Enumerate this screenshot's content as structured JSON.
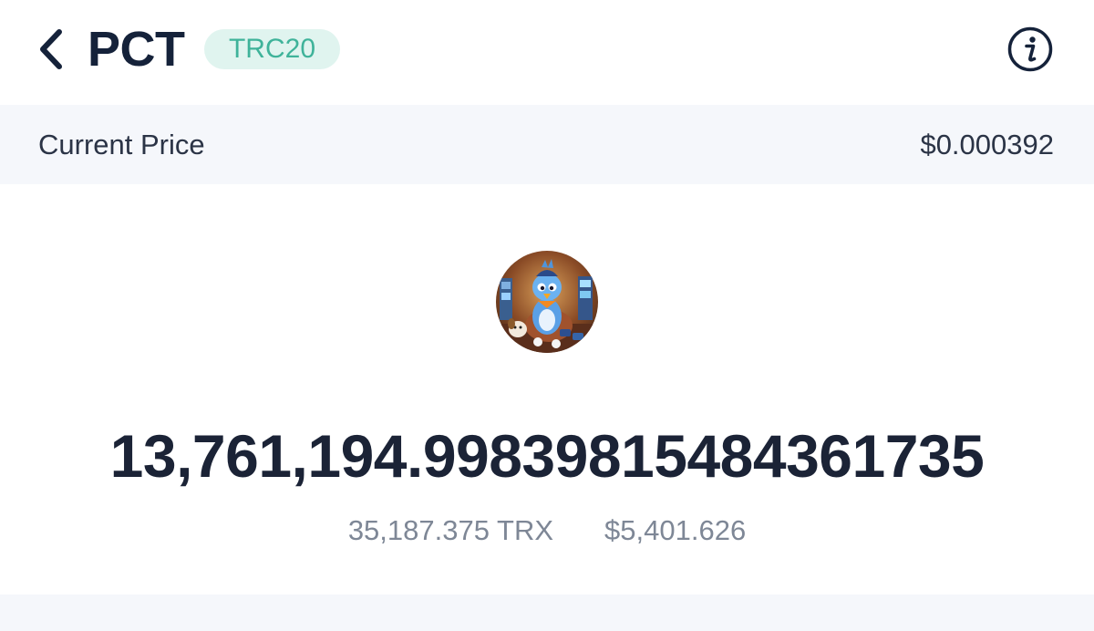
{
  "header": {
    "back_icon": "chevron-left-icon",
    "symbol": "PCT",
    "badge": "TRC20",
    "info_icon": "info-circle-icon"
  },
  "price": {
    "label": "Current Price",
    "value": "$0.000392"
  },
  "token": {
    "avatar": "bird-mascot-avatar"
  },
  "balance": {
    "amount": "13,761,194.99839815484361735",
    "trx_value": "35,187.375 TRX",
    "usd_value": "$5,401.626"
  },
  "colors": {
    "badge_bg": "#e0f4ef",
    "badge_text": "#3fb39a",
    "price_bar_bg": "#f5f7fb",
    "primary_text": "#1b2336",
    "secondary_text": "#7e8796"
  }
}
